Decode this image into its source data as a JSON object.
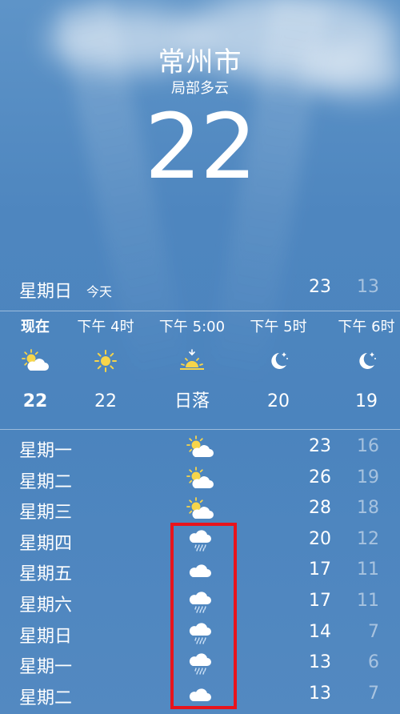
{
  "header": {
    "city": "常州市",
    "condition": "局部多云",
    "temperature": "22"
  },
  "today": {
    "day": "星期日",
    "label": "今天",
    "high": "23",
    "low": "13"
  },
  "hourly": [
    {
      "time": "现在",
      "icon": "partly-cloudy-day-icon",
      "value": "22",
      "bold": true
    },
    {
      "time": "下午 4时",
      "icon": "sun-icon",
      "value": "22",
      "bold": false
    },
    {
      "time": "下午 5:00",
      "icon": "sunset-icon",
      "value": "日落",
      "bold": false
    },
    {
      "time": "下午 5时",
      "icon": "moon-stars-icon",
      "value": "20",
      "bold": false
    },
    {
      "time": "下午 6时",
      "icon": "moon-stars-icon",
      "value": "19",
      "bold": false
    }
  ],
  "daily": [
    {
      "day": "星期一",
      "icon": "partly-cloudy-day-icon",
      "high": "23",
      "low": "16"
    },
    {
      "day": "星期二",
      "icon": "partly-cloudy-day-icon",
      "high": "26",
      "low": "19"
    },
    {
      "day": "星期三",
      "icon": "partly-cloudy-day-icon",
      "high": "28",
      "low": "18"
    },
    {
      "day": "星期四",
      "icon": "rain-cloud-icon",
      "high": "20",
      "low": "12"
    },
    {
      "day": "星期五",
      "icon": "cloud-icon",
      "high": "17",
      "low": "11"
    },
    {
      "day": "星期六",
      "icon": "rain-cloud-icon",
      "high": "17",
      "low": "11"
    },
    {
      "day": "星期日",
      "icon": "rain-cloud-icon",
      "high": "14",
      "low": "7"
    },
    {
      "day": "星期一",
      "icon": "rain-cloud-icon",
      "high": "13",
      "low": "6"
    },
    {
      "day": "星期二",
      "icon": "cloud-icon",
      "high": "13",
      "low": "7"
    }
  ],
  "colors": {
    "background_top": "#5e94c8",
    "background_bottom": "#5389c1",
    "sun": "#f7d54a",
    "highlight_box": "#e8141c"
  }
}
